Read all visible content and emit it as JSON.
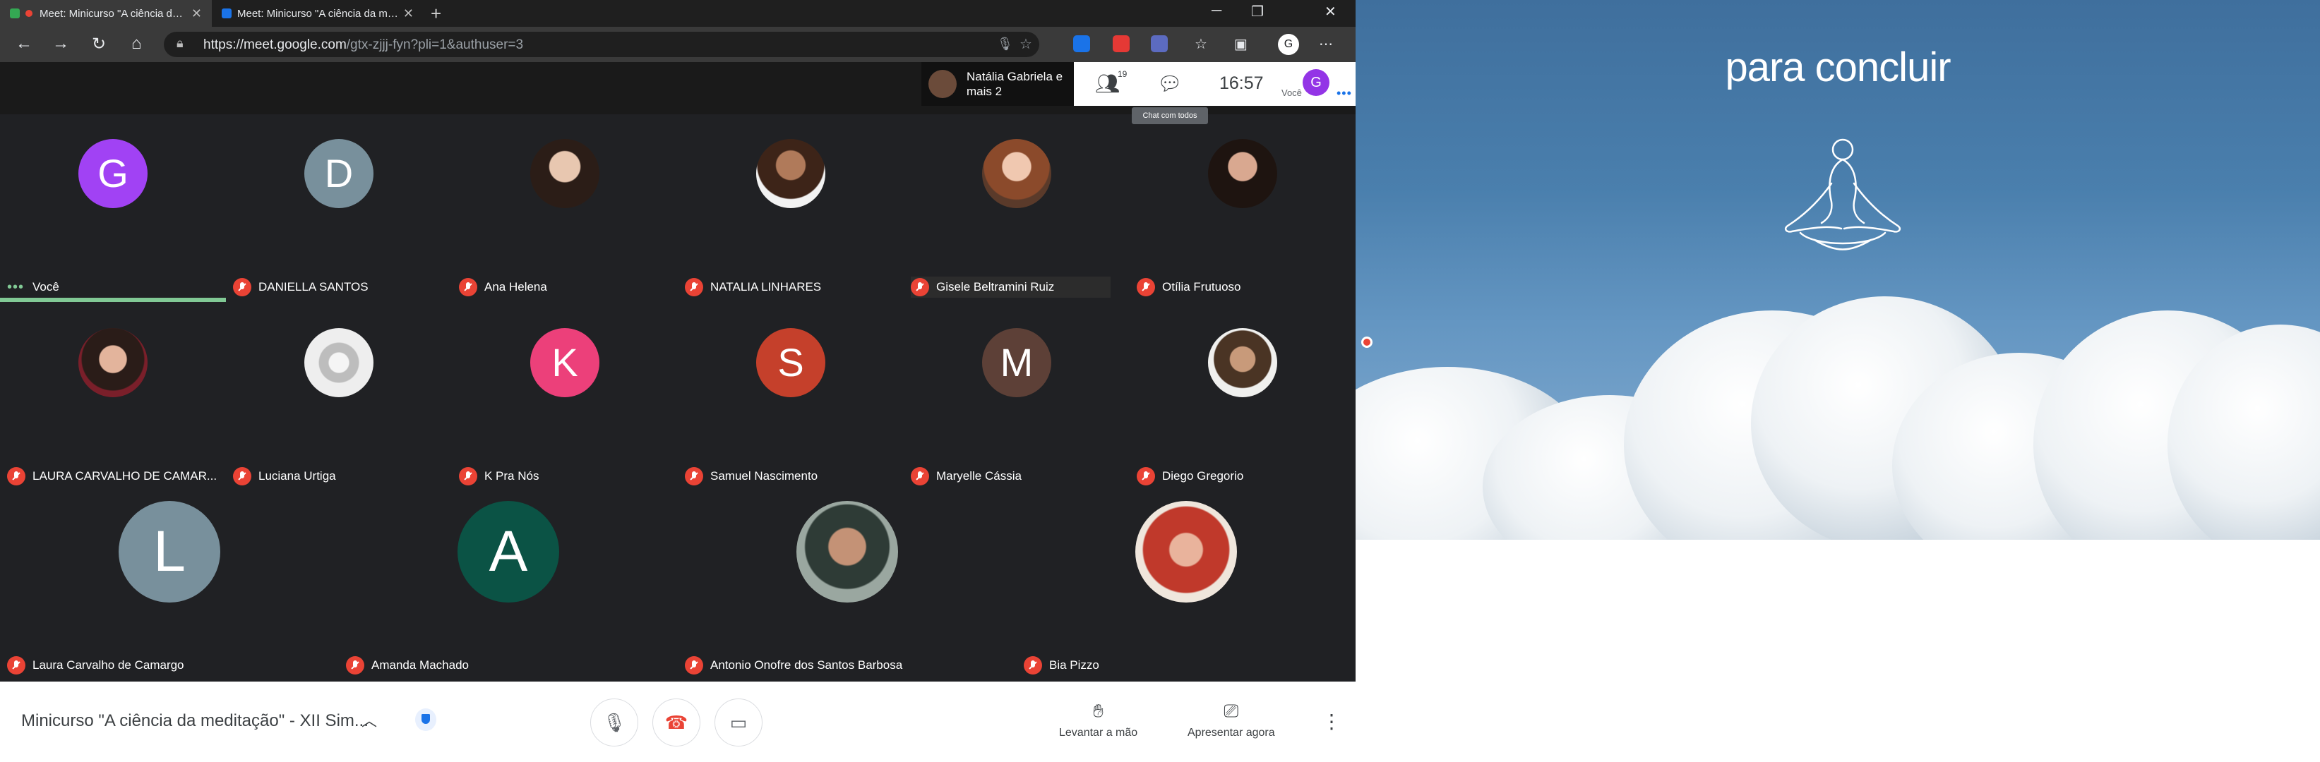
{
  "browser": {
    "tabs": [
      {
        "title": "Meet: Minicurso \"A ciência d…",
        "active": true
      },
      {
        "title": "Meet: Minicurso \"A ciência da m…",
        "active": false
      }
    ],
    "url_main": "https://meet.google.com",
    "url_path": "/gtx-zjjj-fyn?pli=1&authuser=3",
    "profile_initial": "G"
  },
  "meet_header": {
    "speaker_name": "Natália Gabriela e mais 2",
    "participants_count": "19",
    "time": "16:57",
    "self_label": "Você",
    "self_initial": "G",
    "tooltip": "Chat com todos"
  },
  "participants": [
    {
      "name": "Você",
      "initial": "G",
      "color": "#a142f4",
      "muted": false,
      "speaking": true
    },
    {
      "name": "DANIELLA SANTOS",
      "initial": "D",
      "color": "#78909c",
      "muted": true
    },
    {
      "name": "Ana Helena",
      "photo": true,
      "muted": true
    },
    {
      "name": "NATALIA LINHARES",
      "photo": true,
      "muted": true
    },
    {
      "name": "Gisele Beltramini Ruiz",
      "photo": true,
      "muted": true,
      "highlight": true
    },
    {
      "name": "Otília Frutuoso",
      "photo": true,
      "muted": true
    },
    {
      "name": "LAURA CARVALHO DE CAMAR...",
      "photo": true,
      "muted": true
    },
    {
      "name": "Luciana Urtiga",
      "photo": true,
      "muted": true
    },
    {
      "name": "K Pra Nós",
      "initial": "K",
      "color": "#ec407a",
      "muted": true
    },
    {
      "name": "Samuel Nascimento",
      "initial": "S",
      "color": "#c5402b",
      "muted": true
    },
    {
      "name": "Maryelle Cássia",
      "initial": "M",
      "color": "#5d4037",
      "muted": true
    },
    {
      "name": "Diego Gregorio",
      "photo": true,
      "muted": true
    },
    {
      "name": "Laura Carvalho de Camargo",
      "initial": "L",
      "color": "#78909c",
      "muted": true
    },
    {
      "name": "Amanda Machado",
      "initial": "A",
      "color": "#0b5345",
      "muted": true
    },
    {
      "name": "Antonio Onofre dos Santos Barbosa",
      "photo": true,
      "muted": true
    },
    {
      "name": "Bia Pizzo",
      "photo": true,
      "muted": true
    }
  ],
  "bottom": {
    "meeting_title": "Minicurso \"A ciência da meditação\" - XII Sim...",
    "raise_hand": "Levantar a mão",
    "present_now": "Apresentar agora"
  },
  "slide": {
    "title": "para concluir"
  }
}
